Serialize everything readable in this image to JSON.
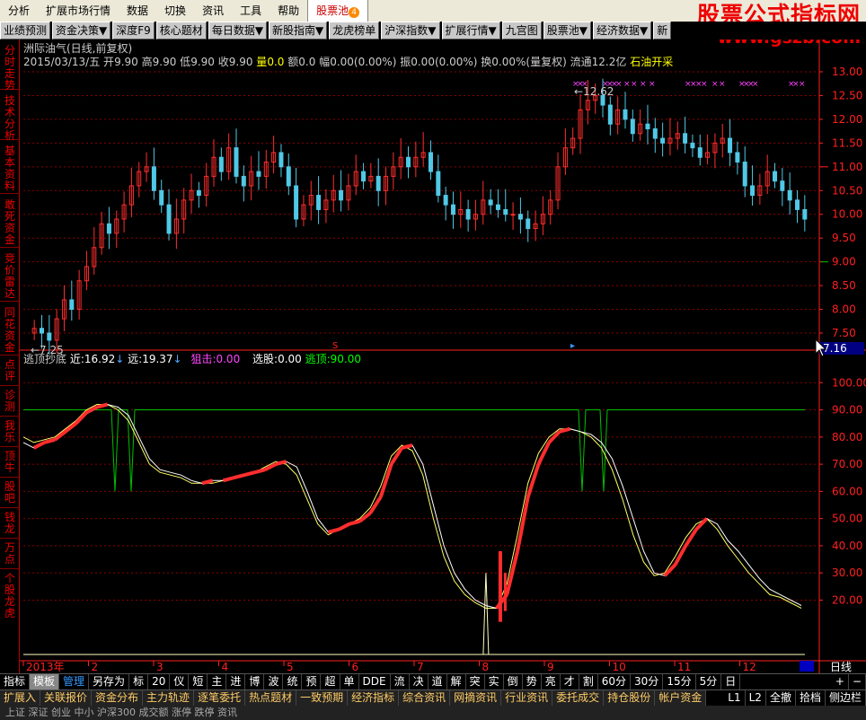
{
  "menu": [
    "分析",
    "扩展市场行情",
    "数据",
    "切换",
    "资讯",
    "工具",
    "帮助"
  ],
  "menu_active": "股票池",
  "menu_badge": "4",
  "watermark": {
    "title": "股票公式指标网",
    "url": "www.gszb.com"
  },
  "toolbar": [
    "业绩预测",
    "资金决策▼",
    "深度F9",
    "核心题材",
    "每日数据▼",
    "新股指南▼",
    "龙虎榜单",
    "沪深指数▼",
    "扩展行情▼",
    "九宫图",
    "股票池▼",
    "经济数据▼",
    "新"
  ],
  "leftnav": [
    "分时走势",
    "技术分析",
    "基本资料",
    "敢死资金",
    "竞价雷达",
    "同花资金",
    "点评",
    "诊测",
    "我乐",
    "顶牛",
    "股吧",
    "钱龙",
    "万点",
    "个股龙虎"
  ],
  "info": {
    "title": "洲际油气(日线,前复权)",
    "date": "2015/03/13/五",
    "open_label": "开",
    "open": "9.90",
    "high_label": "高",
    "high": "9.90",
    "low_label": "低",
    "low": "9.90",
    "close_label": "收",
    "close": "9.90",
    "vol_label": "量",
    "vol": "0.0",
    "amt_label": "额",
    "amt": "0.0",
    "chg_label": "幅",
    "chg": "0.00(0.00%)",
    "amp_label": "振",
    "amp": "0.00(0.00%)",
    "turn_label": "换",
    "turn": "0.00%(量复权)",
    "float_label": "流通",
    "float": "12.2亿",
    "sector": "石油开采"
  },
  "indicator": {
    "name": "逃顶抄底",
    "near_label": "近:",
    "near": "16.92",
    "far_label": "远:",
    "far": "19.37",
    "snipe_label": "狙击:",
    "snipe": "0.00",
    "pick_label": "选股:",
    "pick": "0.00",
    "top_label": "逃顶:",
    "top": "90.00"
  },
  "price_axis": [
    "13.00",
    "12.50",
    "12.00",
    "11.50",
    "11.00",
    "10.50",
    "10.00",
    "9.50",
    "9.00",
    "8.50",
    "8.00",
    "7.50"
  ],
  "price_box": "7.16",
  "max_label": "12.62",
  "min_label": "7.25",
  "ind_axis": [
    "100.00",
    "90.00",
    "80.00",
    "70.00",
    "60.00",
    "50.00",
    "40.00",
    "30.00",
    "20.00"
  ],
  "date_axis": [
    "2013年",
    "2",
    "3",
    "4",
    "5",
    "6",
    "7",
    "8",
    "9",
    "10",
    "11",
    "12"
  ],
  "period_label": "日线",
  "bottom1": [
    "指标",
    "模板",
    "管理",
    "另存为",
    "标",
    "20",
    "仪",
    "短",
    "主",
    "进",
    "博",
    "波",
    "统",
    "预",
    "超",
    "单",
    "DDE",
    "流",
    "决",
    "道",
    "解",
    "突",
    "实",
    "倒",
    "势",
    "亮",
    "才",
    "割",
    "60分",
    "30分",
    "15分",
    "5分",
    "日"
  ],
  "bottom1_right": [
    "+",
    "−"
  ],
  "bottom2": [
    "扩展入",
    "关联报价",
    "资金分布",
    "主力轨迹",
    "逐笔委托",
    "热点题材",
    "一致预期",
    "经济指标",
    "综合资讯",
    "网摘资讯",
    "行业资讯",
    "委托成交",
    "持仓股份",
    "帐户资金"
  ],
  "bottom2_right": [
    "L1",
    "L2",
    "全撤",
    "拾档",
    "侧边栏"
  ],
  "status": "上证  深证  创业  中小  沪深300  成交额  涨停  跌停  资讯",
  "colors": {
    "up": "#ff2d2d",
    "down": "#50c8e6",
    "grid": "#8b0000",
    "axis": "#ff2020",
    "line_white": "#ffffff",
    "line_yellow": "#ffff64",
    "green": "#00c000",
    "magenta": "#ff40ff"
  },
  "chart_data": {
    "type": "line",
    "close_prices": [
      7.6,
      7.5,
      7.35,
      7.8,
      8.2,
      8.0,
      8.6,
      8.9,
      9.3,
      9.8,
      9.6,
      9.9,
      10.2,
      10.6,
      10.9,
      11.0,
      10.5,
      10.2,
      9.6,
      9.9,
      10.3,
      10.5,
      10.4,
      10.8,
      11.2,
      10.9,
      11.4,
      10.8,
      10.6,
      10.9,
      10.8,
      11.1,
      11.3,
      11.0,
      10.6,
      9.9,
      10.2,
      10.4,
      10.1,
      10.3,
      10.5,
      10.3,
      10.6,
      10.9,
      10.7,
      10.8,
      10.5,
      10.8,
      11.0,
      11.2,
      11.0,
      11.2,
      11.3,
      10.9,
      10.4,
      10.2,
      10.0,
      10.1,
      9.9,
      10.0,
      10.3,
      10.2,
      10.1,
      10.0,
      10.0,
      9.9,
      9.7,
      9.8,
      10.0,
      10.3,
      11.0,
      11.4,
      11.6,
      12.2,
      12.4,
      12.5,
      12.3,
      11.9,
      12.2,
      12.0,
      11.7,
      11.9,
      11.8,
      11.6,
      11.5,
      11.6,
      11.7,
      11.5,
      11.4,
      11.2,
      11.3,
      11.5,
      11.6,
      11.3,
      11.1,
      10.6,
      10.4,
      10.6,
      10.9,
      10.7,
      10.5,
      10.3,
      10.1,
      9.9
    ],
    "indicator_white": [
      78,
      76,
      78,
      79,
      82,
      85,
      89,
      91,
      92,
      91,
      88,
      80,
      72,
      68,
      67,
      66,
      64,
      63,
      64,
      64,
      65,
      66,
      67,
      68,
      70,
      71,
      69,
      60,
      50,
      45,
      46,
      48,
      49,
      52,
      58,
      70,
      76,
      77,
      70,
      55,
      40,
      30,
      24,
      20,
      18,
      17,
      22,
      38,
      58,
      70,
      78,
      82,
      83,
      82,
      81,
      78,
      72,
      62,
      50,
      38,
      30,
      29,
      33,
      40,
      46,
      50,
      48,
      42,
      38,
      33,
      28,
      24,
      22,
      20,
      18
    ],
    "indicator_yellow": [
      80,
      78,
      79,
      80,
      83,
      86,
      90,
      92,
      92,
      90,
      86,
      78,
      70,
      67,
      66,
      65,
      63,
      63,
      63,
      64,
      65,
      66,
      67,
      69,
      71,
      70,
      66,
      57,
      48,
      44,
      46,
      48,
      50,
      54,
      62,
      73,
      77,
      75,
      66,
      50,
      36,
      27,
      22,
      19,
      17,
      17,
      26,
      44,
      63,
      74,
      80,
      83,
      83,
      82,
      80,
      76,
      68,
      57,
      44,
      34,
      29,
      30,
      36,
      43,
      48,
      50,
      46,
      40,
      35,
      30,
      26,
      22,
      21,
      19,
      17
    ],
    "snipe_spikes": [
      {
        "x": "2013-02",
        "value": 60
      },
      {
        "x": "2013-02",
        "value": 60
      },
      {
        "x": "2013-09",
        "value": 60
      },
      {
        "x": "2013-09",
        "value": 60
      }
    ],
    "bottom_spike_value": 30,
    "top_line": 90,
    "ylim_price": [
      7.16,
      13.0
    ],
    "ylim_indicator": [
      0,
      110
    ]
  }
}
